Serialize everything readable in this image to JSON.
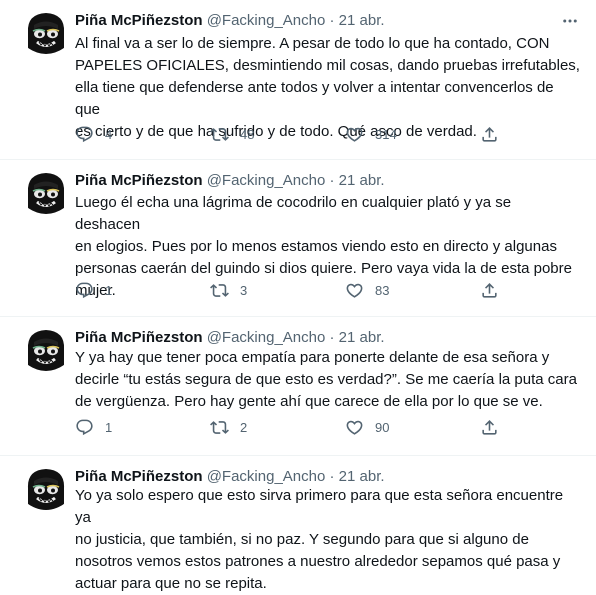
{
  "tweets": [
    {
      "name": "Piña McPiñezston",
      "handle": "@Facking_Ancho",
      "sep": " · ",
      "date": "21 abr.",
      "more_label": "···",
      "text": "Al final va a ser lo de siempre. A pesar de todo lo que ha contado, CON\nPAPELES OFICIALES, desmintiendo mil cosas, dando pruebas irrefutables,\nella tiene que defenderse ante todos y volver a intentar convencerlos de que\nes cierto y de que ha sufrido y de todo. Qué asco de verdad.",
      "replies": "4",
      "retweets": "48",
      "likes": "314"
    },
    {
      "name": "Piña McPiñezston",
      "handle": "@Facking_Ancho",
      "sep": " · ",
      "date": "21 abr.",
      "more_label": "",
      "text": "Luego él echa una lágrima de cocodrilo en cualquier plató y ya se deshacen\nen elogios. Pues por lo menos estamos viendo esto en directo y algunas\npersonas caerán del guindo si dios quiere. Pero vaya vida la de esta pobre\nmujer.",
      "replies": "1",
      "retweets": "3",
      "likes": "83"
    },
    {
      "name": "Piña McPiñezston",
      "handle": "@Facking_Ancho",
      "sep": " · ",
      "date": "21 abr.",
      "more_label": "",
      "text": "Y ya hay que tener poca empatía para ponerte delante de esa señora y\ndecirle “tu estás segura de que esto es verdad?”. Se me caería la puta cara\nde vergüenza. Pero hay gente ahí que carece de ella por lo que se ve.",
      "replies": "1",
      "retweets": "2",
      "likes": "90"
    },
    {
      "name": "Piña McPiñezston",
      "handle": "@Facking_Ancho",
      "sep": " · ",
      "date": "21 abr.",
      "more_label": "",
      "text": "Yo ya solo espero que esto sirva primero para que esta señora encuentre ya\nno justicia, que también, si no paz. Y segundo para que si alguno de\nnosotros vemos estos patrones a nuestro alrededor sepamos qué pasa y\nactuar para que no se repita."
    }
  ],
  "icons": {
    "reply": "reply-icon",
    "retweet": "retweet-icon",
    "like": "heart-icon",
    "share": "share-icon",
    "more": "more-icon",
    "avatar": "avatar-cartoon-face"
  },
  "colors": {
    "text": "#0f1419",
    "secondary": "#536471",
    "divider": "#eff3f4",
    "background": "#ffffff"
  }
}
